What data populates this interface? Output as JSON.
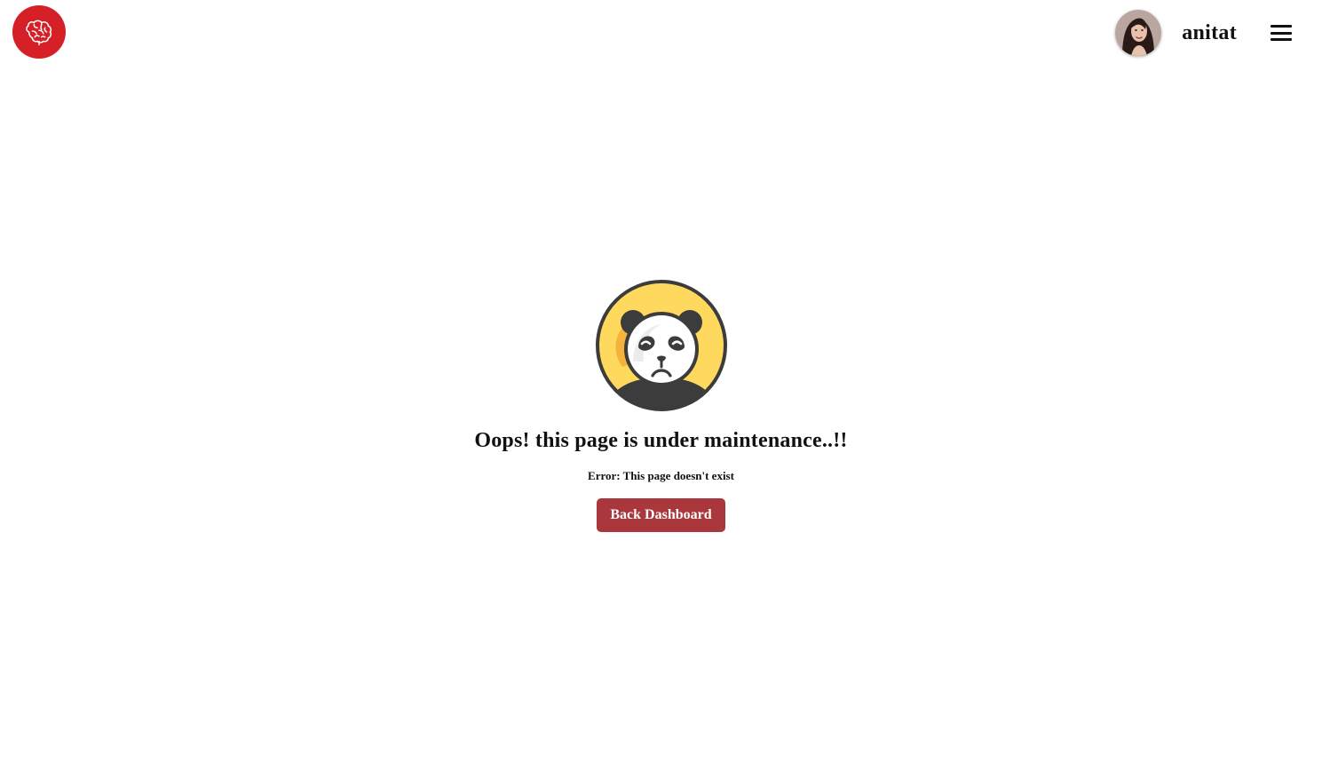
{
  "header": {
    "logo_icon": "brain-icon",
    "logo_color": "#d52027",
    "username": "anitat",
    "menu_icon": "hamburger-menu-icon"
  },
  "main": {
    "illustration_icon": "sad-panda-icon",
    "title": "Oops! this page is under maintenance..!!",
    "error_message": "Error: This page doesn't exist",
    "back_button_label": "Back Dashboard",
    "button_color": "#a9373b"
  }
}
